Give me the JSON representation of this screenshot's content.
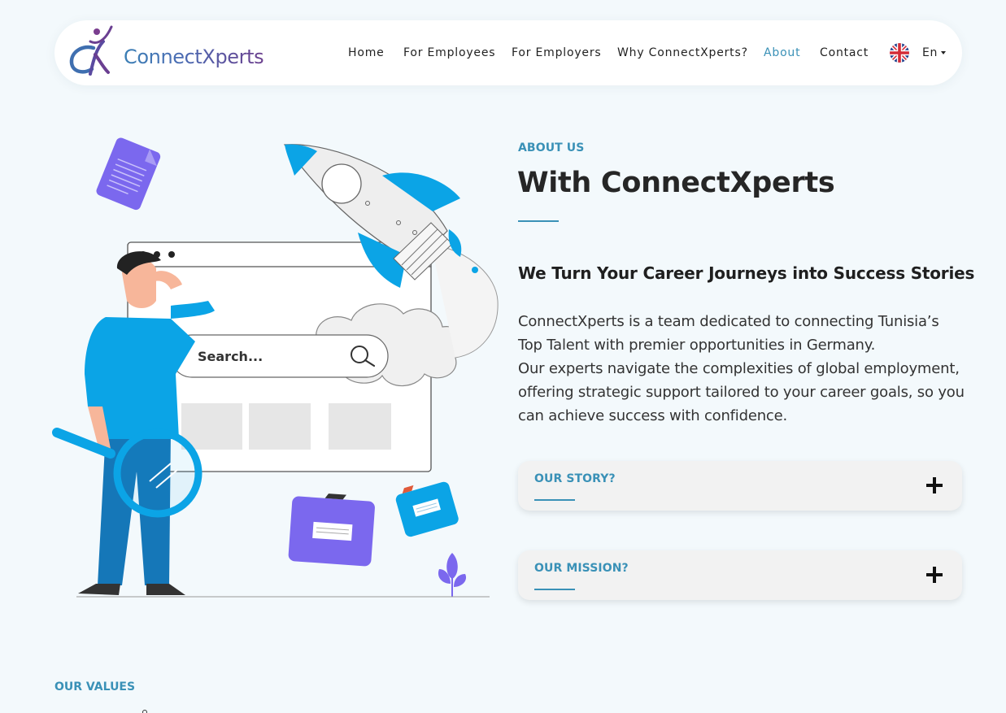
{
  "nav": {
    "logo_text": "ConnectXperts",
    "links": [
      {
        "label": "Home"
      },
      {
        "label": "For Employees"
      },
      {
        "label": "For Employers"
      },
      {
        "label": "Why ConnectXperts?"
      },
      {
        "label": "About"
      },
      {
        "label": "Contact"
      }
    ],
    "active": "About",
    "language": {
      "label": "En",
      "flag_icon": "uk-flag-icon"
    }
  },
  "illustration": {
    "search_placeholder": "Search..."
  },
  "about": {
    "eyebrow": "ABOUT US",
    "headline": "With ConnectXperts",
    "subheadline": "We Turn Your Career Journeys into Success Stories",
    "paragraph_1": "ConnectXperts is a team dedicated to connecting Tunisia’s Top Talent with premier opportunities in Germany.",
    "paragraph_2": "Our experts navigate the complexities of global employment, offering strategic support tailored to your career goals, so you can achieve success with confidence."
  },
  "accordions": [
    {
      "title": "OUR STORY?",
      "icon": "plus-icon"
    },
    {
      "title": "OUR MISSION?",
      "icon": "plus-icon"
    }
  ],
  "values": {
    "label": "OUR VALUES"
  },
  "colors": {
    "accent": "#3a91b7",
    "background": "#f3f9fc",
    "heading": "#262626",
    "illustration_blue": "#0ba4e6",
    "illustration_purple": "#7b68ee"
  }
}
